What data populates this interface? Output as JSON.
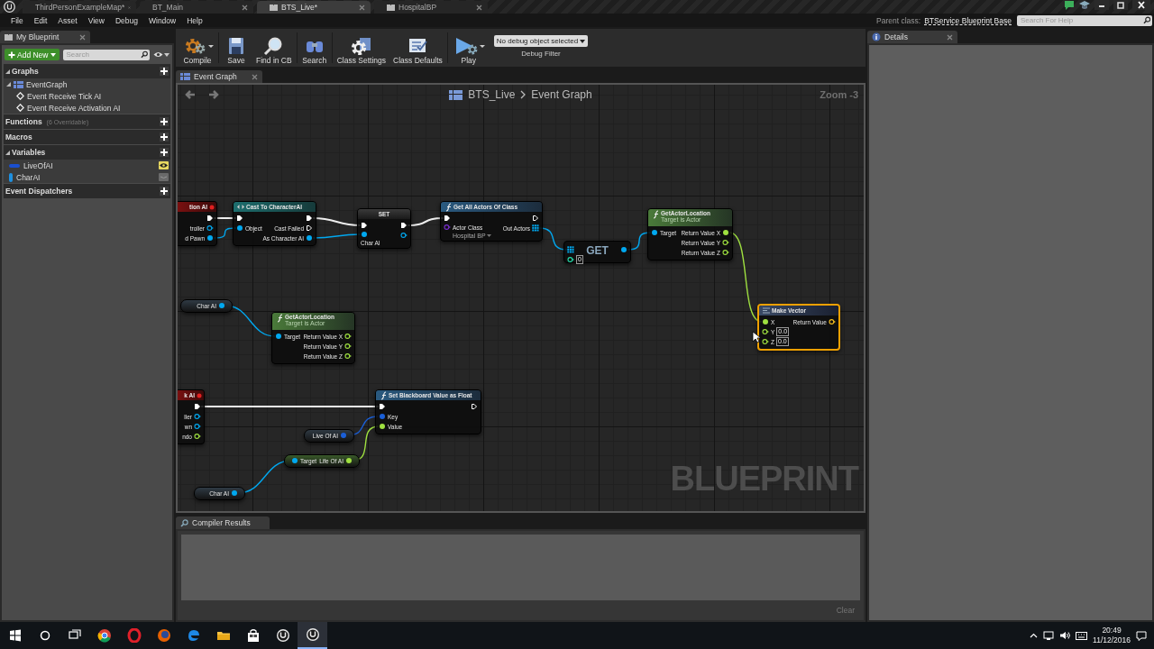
{
  "title_bar": {
    "tabs": [
      {
        "label": "ThirdPersonExampleMap*",
        "kind": "map",
        "selected": false
      },
      {
        "label": "BT_Main",
        "kind": "behavior_tree",
        "selected": false
      },
      {
        "label": "BTS_Live*",
        "kind": "blueprint",
        "selected": true
      },
      {
        "label": "HospitalBP",
        "kind": "blueprint",
        "selected": false
      }
    ]
  },
  "menu": [
    "File",
    "Edit",
    "Asset",
    "View",
    "Debug",
    "Window",
    "Help"
  ],
  "parent_class": {
    "label": "Parent class:",
    "value": "BTService Blueprint Base"
  },
  "help_search": {
    "placeholder": "Search For Help"
  },
  "my_blueprint": {
    "tab": "My Blueprint",
    "add_button": "Add New",
    "search": {
      "placeholder": "Search"
    },
    "sections": [
      {
        "title": "Graphs",
        "items": [
          {
            "label": "EventGraph",
            "kind": "graph",
            "children": [
              {
                "label": "Event Receive Tick AI",
                "kind": "event"
              },
              {
                "label": "Event Receive Activation AI",
                "kind": "event"
              }
            ]
          }
        ]
      },
      {
        "title": "Functions",
        "note": "(6 Overridable)"
      },
      {
        "title": "Macros"
      },
      {
        "title": "Variables",
        "variables": [
          {
            "label": "LiveOfAI",
            "color": "#1a4fd0",
            "exposed": true
          },
          {
            "label": "CharAI",
            "color": "#1e90e0",
            "exposed": false
          }
        ]
      },
      {
        "title": "Event Dispatchers"
      }
    ]
  },
  "toolbar": {
    "buttons": [
      {
        "label": "Compile",
        "kind": "compile",
        "menu": true
      },
      {
        "label": "Save",
        "kind": "save",
        "menu": false
      },
      {
        "label": "Find in CB",
        "kind": "find",
        "menu": false
      },
      {
        "label": "Search",
        "kind": "search",
        "menu": false
      },
      {
        "label": "Class Settings",
        "kind": "settings",
        "menu": false
      },
      {
        "label": "Class Defaults",
        "kind": "defaults",
        "menu": false
      },
      {
        "label": "Play",
        "kind": "play",
        "menu": true
      }
    ],
    "debug_filter": {
      "value": "No debug object selected",
      "label": "Debug Filter"
    }
  },
  "graph": {
    "tab": "Event Graph",
    "breadcrumb": [
      "BTS_Live",
      "Event Graph"
    ],
    "zoom": "Zoom -3",
    "watermark": "BLUEPRINT",
    "nodes": [
      {
        "kind": "event",
        "title": "tion AI",
        "selected": false,
        "rows": [
          {
            "out": {
              "kind": "exec",
              "connected": true
            }
          },
          {
            "out": {
              "label": "troller",
              "kind": "object",
              "connected": false
            }
          },
          {
            "out": {
              "label": "d Pawn",
              "kind": "object",
              "connected": true
            }
          }
        ]
      },
      {
        "kind": "cast",
        "title": "Cast To CharacterAI",
        "selected": false,
        "rows": [
          {
            "in": {
              "kind": "exec",
              "connected": true
            },
            "out": {
              "kind": "exec",
              "connected": true
            }
          },
          {
            "in": {
              "label": "Object",
              "kind": "object",
              "connected": true
            },
            "out": {
              "label": "Cast Failed",
              "kind": "exec",
              "connected": false
            }
          },
          {
            "out": {
              "label": "As Character AI",
              "kind": "object",
              "connected": true
            }
          }
        ]
      },
      {
        "kind": "set",
        "title": "SET",
        "selected": false,
        "rows": [
          {
            "in": {
              "kind": "exec",
              "connected": true
            },
            "out": {
              "kind": "exec",
              "connected": true
            }
          },
          {
            "in": {
              "label": "Char AI",
              "kind": "object",
              "connected": true
            },
            "out": {
              "kind": "object",
              "connected": false
            }
          }
        ]
      },
      {
        "kind": "function",
        "title": "Get All Actors Of Class",
        "selected": false,
        "rows": [
          {
            "in": {
              "kind": "exec",
              "connected": true
            },
            "out": {
              "kind": "exec",
              "connected": false
            }
          },
          {
            "in": {
              "label": "Actor Class",
              "kind": "class",
              "connected": false,
              "value": "Hospital BP"
            },
            "out": {
              "label": "Out Actors",
              "kind": "array",
              "connected": true
            }
          }
        ]
      },
      {
        "kind": "get",
        "title": "GET",
        "selected": false,
        "rows": [
          {
            "in": {
              "kind": "array",
              "connected": true
            },
            "out": {
              "kind": "object",
              "connected": true
            }
          },
          {
            "in": {
              "kind": "int",
              "connected": false,
              "value": "0"
            }
          }
        ]
      },
      {
        "kind": "pure",
        "title": "GetActorLocation",
        "subtitle": "Target is Actor",
        "selected": false,
        "rows": [
          {
            "in": {
              "label": "Target",
              "kind": "object",
              "connected": true
            },
            "out": {
              "label": "Return Value X",
              "kind": "float",
              "connected": true
            }
          },
          {
            "out": {
              "label": "Return Value Y",
              "kind": "float",
              "connected": false
            }
          },
          {
            "out": {
              "label": "Return Value Z",
              "kind": "float",
              "connected": false
            }
          }
        ]
      },
      {
        "kind": "struct",
        "title": "Make Vector",
        "selected": true,
        "rows": [
          {
            "in": {
              "label": "X",
              "kind": "float",
              "connected": true
            },
            "out": {
              "label": "Return Value",
              "kind": "vector",
              "connected": false
            }
          },
          {
            "in": {
              "label": "Y",
              "kind": "float",
              "connected": false,
              "value": "0.0"
            }
          },
          {
            "in": {
              "label": "Z",
              "kind": "float",
              "connected": false,
              "value": "0.0"
            }
          }
        ]
      },
      {
        "kind": "variable",
        "selected": false,
        "rows": [
          {
            "out": {
              "label": "Char AI",
              "kind": "object",
              "connected": true
            }
          }
        ]
      },
      {
        "kind": "pure",
        "title": "GetActorLocation",
        "subtitle": "Target is Actor",
        "selected": false,
        "rows": [
          {
            "in": {
              "label": "Target",
              "kind": "object",
              "connected": true
            },
            "out": {
              "label": "Return Value X",
              "kind": "float",
              "connected": false
            }
          },
          {
            "out": {
              "label": "Return Value Y",
              "kind": "float",
              "connected": false
            }
          },
          {
            "out": {
              "label": "Return Value Z",
              "kind": "float",
              "connected": false
            }
          }
        ]
      },
      {
        "kind": "event",
        "title": "k AI",
        "selected": false,
        "rows": [
          {
            "out": {
              "kind": "exec",
              "connected": true
            }
          },
          {
            "out": {
              "label": "ller",
              "kind": "object",
              "connected": false
            }
          },
          {
            "out": {
              "label": "wn",
              "kind": "object",
              "connected": false
            }
          },
          {
            "out": {
              "label": "ndo",
              "kind": "float",
              "connected": false
            }
          }
        ]
      },
      {
        "kind": "function",
        "title": "Set Blackboard Value as Float",
        "selected": false,
        "rows": [
          {
            "in": {
              "kind": "exec",
              "connected": true
            },
            "out": {
              "kind": "exec",
              "connected": false
            }
          },
          {
            "in": {
              "label": "Key",
              "kind": "struct",
              "connected": true
            }
          },
          {
            "in": {
              "label": "Value",
              "kind": "float",
              "connected": true
            }
          }
        ]
      },
      {
        "kind": "variable",
        "selected": false,
        "rows": [
          {
            "out": {
              "label": "Live Of AI",
              "kind": "struct",
              "connected": true
            }
          }
        ]
      },
      {
        "kind": "member_get",
        "selected": false,
        "rows": [
          {
            "in": {
              "label": "Target",
              "kind": "object",
              "connected": true
            },
            "out": {
              "label": "Life Of AI",
              "kind": "float",
              "connected": true
            }
          }
        ]
      },
      {
        "kind": "variable",
        "selected": false,
        "rows": [
          {
            "out": {
              "label": "Char AI",
              "kind": "object",
              "connected": true
            }
          }
        ]
      }
    ]
  },
  "details": {
    "tab": "Details"
  },
  "compiler_results": {
    "tab": "Compiler Results",
    "clear": "Clear"
  },
  "taskbar": {
    "apps": [
      {
        "kind": "start",
        "active": false
      },
      {
        "kind": "search",
        "active": false
      },
      {
        "kind": "taskview",
        "active": false
      },
      {
        "kind": "chrome",
        "active": false
      },
      {
        "kind": "opera",
        "active": false
      },
      {
        "kind": "firefox",
        "active": false
      },
      {
        "kind": "edge",
        "active": false
      },
      {
        "kind": "explorer",
        "active": false
      },
      {
        "kind": "store",
        "active": false
      },
      {
        "kind": "unreal",
        "active": false
      },
      {
        "kind": "unreal",
        "active": true
      }
    ],
    "time": "20:49",
    "date": "11/12/2016"
  }
}
